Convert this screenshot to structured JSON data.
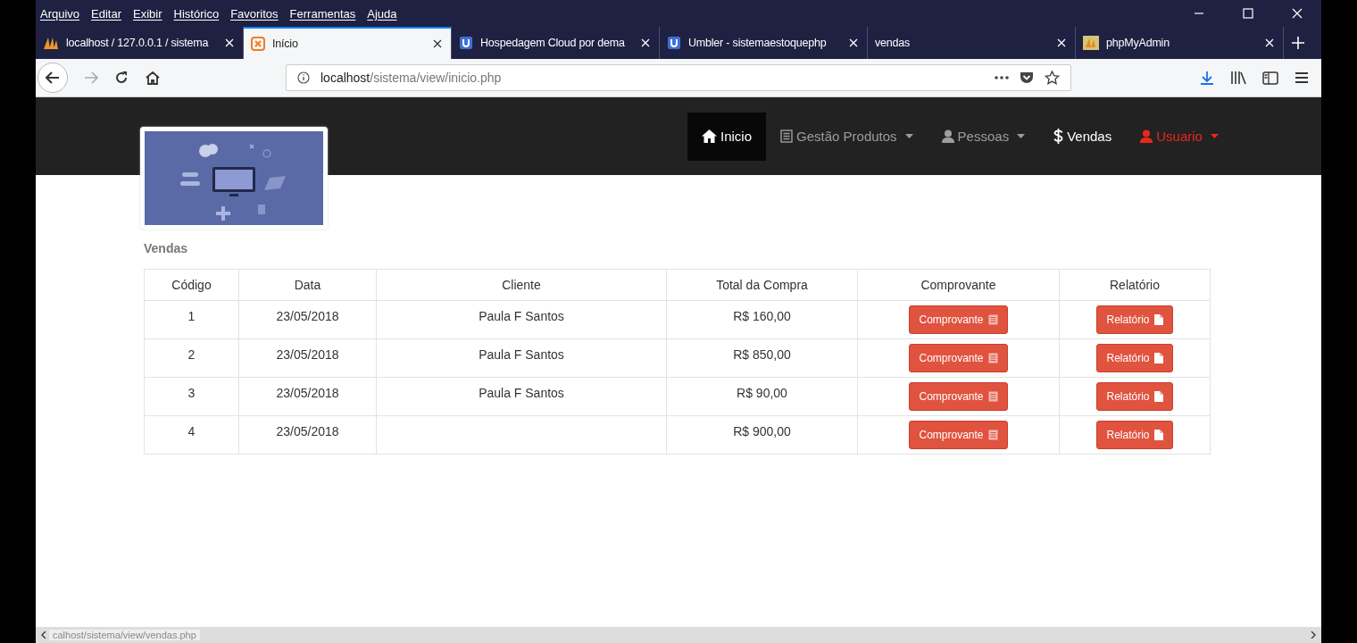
{
  "menu_bar": [
    "Arquivo",
    "Editar",
    "Exibir",
    "Histórico",
    "Favoritos",
    "Ferramentas",
    "Ajuda"
  ],
  "tabs": [
    {
      "title": "localhost / 127.0.0.1 / sistema",
      "kind": "sails",
      "selected": false
    },
    {
      "title": "Início",
      "kind": "xampp",
      "selected": true
    },
    {
      "title": "Hospedagem Cloud por dema",
      "kind": "umbler",
      "selected": false
    },
    {
      "title": "Umbler - sistemaestoquephp",
      "kind": "umbler",
      "selected": false
    },
    {
      "title": "vendas",
      "kind": "plain",
      "selected": false
    },
    {
      "title": "phpMyAdmin",
      "kind": "pma",
      "selected": false
    }
  ],
  "address_bar": {
    "host": "localhost",
    "path": "/sistema/view/inicio.php"
  },
  "navbar": [
    {
      "label": "Inicio",
      "kind": "home",
      "selected": true,
      "dropdown": false,
      "color": "#ffffff"
    },
    {
      "label": "Gestão Produtos",
      "kind": "list",
      "selected": false,
      "dropdown": true,
      "color": "#9d9d9d"
    },
    {
      "label": "Pessoas",
      "kind": "person",
      "selected": false,
      "dropdown": true,
      "color": "#9d9d9d"
    },
    {
      "label": "Vendas",
      "kind": "dollar",
      "selected": false,
      "dropdown": false,
      "color": "#ffffff"
    },
    {
      "label": "Usuario",
      "kind": "person",
      "selected": false,
      "dropdown": true,
      "color": "#e8281e"
    }
  ],
  "section_title": "Vendas",
  "table": {
    "columns": [
      "Código",
      "Data",
      "Cliente",
      "Total da Compra",
      "Comprovante",
      "Relatório"
    ],
    "rows": [
      {
        "codigo": "1",
        "data": "23/05/2018",
        "cliente": "Paula F Santos",
        "total": "R$ 160,00",
        "comprovante": "Comprovante",
        "relatorio": "Relatório"
      },
      {
        "codigo": "2",
        "data": "23/05/2018",
        "cliente": "Paula F Santos",
        "total": "R$ 850,00",
        "comprovante": "Comprovante",
        "relatorio": "Relatório"
      },
      {
        "codigo": "3",
        "data": "23/05/2018",
        "cliente": "Paula F Santos",
        "total": "R$ 90,00",
        "comprovante": "Comprovante",
        "relatorio": "Relatório"
      },
      {
        "codigo": "4",
        "data": "23/05/2018",
        "total": "R$ 900,00",
        "comprovante": "Comprovante",
        "relatorio": "Relatório"
      }
    ]
  },
  "status_bar": "calhost/sistema/view/vendas.php"
}
